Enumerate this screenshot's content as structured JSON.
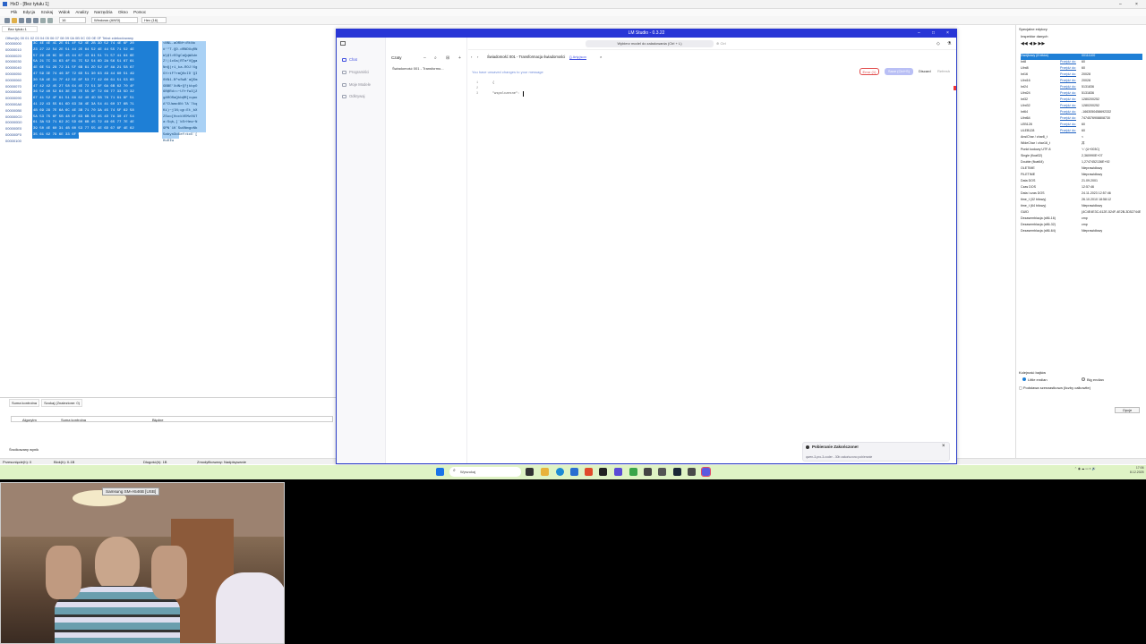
{
  "hxd": {
    "title": "HxD - [Bez tytułu 1]",
    "menu": [
      "Plik",
      "Edycja",
      "Szukaj",
      "Widok",
      "Analizy",
      "Narzędzia",
      "Okno",
      "Pomoc"
    ],
    "toolbar": {
      "cols": "16",
      "charset": "Windows (ANSI)",
      "mode": "Hex (16)"
    },
    "tab": "Bez tytułu 1",
    "header": "Offset(h) 00 01 02 03 04 05 06 07 08 09 0A 0B 0C 0D 0E 0F  Tekst zdekodowany",
    "offsets": [
      "00000000",
      "00000010",
      "00000020",
      "00000030",
      "00000040",
      "00000050",
      "00000060",
      "00000070",
      "00000080",
      "00000090",
      "000000A0",
      "000000B0",
      "000000C0",
      "000000D0",
      "000000E0",
      "000000F0",
      "00000100"
    ],
    "hex_rows": [
      "3C 4E 4E 4C 2E 61 4F 52 4E 2B 3D 52 74 4E 6F 20",
      "23 27 22 54 2E 51 44 2E 64 52 4E 44 55 71 52 4E",
      "57 29 40 6C 3E 45 44 67 43 61 51 71 57 41 64 6E",
      "5A 21 7C 31 63 4F 61 7C 52 54 6D 2A 56 51 67 61",
      "4E 6E 51 28 72 31 5F 6B 61 2D 52 4F 4A 21 58 67",
      "47 59 3E 74 46 3F 72 6D 51 30 63 49 44 60 51 49",
      "30 58 4E 31 7F 42 5E 6F 53 77 42 60 61 51 53 6D",
      "47 42 42 45 27 58 64 4E 72 51 3F 6A 6B 62 70 4F",
      "36 52 40 52 64 3E 3D 7E 55 3F 72 66 77 33 5D 32",
      "67 41 52 4F 61 51 68 62 40 4D 5B 76 71 61 6F 51",
      "41 22 43 55 61 6D 63 38 4E 3A 54 41 60 37 6B 71",
      "4B 69 29 7E 6A 6C 4E 3B 71 70 3A 45 74 5F 62 58",
      "5A 53 75 6F 5B 48 6F 63 6B 56 45 4D 7A 30 47 54",
      "61 3A 53 71 62 2C 5D 60 6B 45 72 48 65 77 7E 4E",
      "39 50 4E 60 31 4B 60 53 77 55 4E 6D 67 6F 4E 62",
      "35 61 62 79 6E 33 6F 58 65 66 3E 6B 63 45 60 5B",
      "48 75 4F 49 77"
    ],
    "ascii_rows": [
      "<NNL.aORN+=RtNo ",
      "#'\"T.QD.dRNDUqRN",
      "W)@l>EDgCaQqWAdn",
      "Z!|1cOa|RTm*VQga",
      "NnQ(r1_ka-ROJ!Xg",
      "GY>tF?rmQ0cID`QI",
      "0XN1.B^oSwB`aQSm",
      "GBBE'XdNrQ?jkbpO",
      "6R@Rd>=~U?rfw3]2",
      "gARORaQhb@M[vqao",
      "A\"CUamc8N:TA`7kq",
      "Ki)~jlN;qp:Et_bX",
      "ZSuo[HockVEMz0GT",
      "a:Sqb,]`kErHew~N",
      "9PN`1K`SwUNmgoNb",
      "5abyn3oXef>kcE`[",
      "HuOIw"
    ],
    "bottom": {
      "tabs": [
        "Suma kontrolna",
        "Szukaj (Znalezione: 0)"
      ],
      "cols": [
        "Algorytm",
        "Suma kontrolna",
        "Błędne"
      ],
      "footer": "Środkowany wynik"
    },
    "status": {
      "pos": "Przesunięcie(h): 0",
      "block": "Blok(h): 0-1B",
      "len": "Długość(h): 1B",
      "mode": "Zmodyfikowany: Nadpisywanie"
    },
    "inspector": {
      "title": "Specjalne edytory",
      "head": "Inspektor danych",
      "link": "Przejdź do:",
      "rows": [
        {
          "n": "Dwójkowy (8 bitów)",
          "l": "",
          "v": "00111100"
        },
        {
          "n": "Int8",
          "l": "Przejdź do:",
          "v": "60"
        },
        {
          "n": "UInt8",
          "l": "Przejdź do:",
          "v": "60"
        },
        {
          "n": "Int16",
          "l": "Przejdź do:",
          "v": "20028"
        },
        {
          "n": "UInt16",
          "l": "Przejdź do:",
          "v": "20028"
        },
        {
          "n": "Int24",
          "l": "Przejdź do:",
          "v": "5131836"
        },
        {
          "n": "UInt24",
          "l": "Przejdź do:",
          "v": "5131836"
        },
        {
          "n": "Int32",
          "l": "Przejdź do:",
          "v": "1280200252"
        },
        {
          "n": "UInt32",
          "l": "Przejdź do:",
          "v": "1280200252"
        },
        {
          "n": "Int64",
          "l": "Przejdź do:",
          "v": "-1663050458692332"
        },
        {
          "n": "UInt64",
          "l": "Przejdź do:",
          "v": "7474576908808730"
        },
        {
          "n": "LEB128",
          "l": "Przejdź do:",
          "v": "60"
        },
        {
          "n": "ULEB128",
          "l": "Przejdź do:",
          "v": "60"
        },
        {
          "n": "AnsiChar / char8_t",
          "l": "",
          "v": "<"
        },
        {
          "n": "WideChar / char16_t",
          "l": "",
          "v": "丼"
        },
        {
          "n": "Punkt kodowy UTF-8",
          "l": "",
          "v": "'<' (U+003C)"
        },
        {
          "n": "Single (float32)",
          "l": "",
          "v": "2,360990E+07"
        },
        {
          "n": "Double (float64)",
          "l": "",
          "v": "1,2747452136E+92"
        },
        {
          "n": "OLETIME",
          "l": "",
          "v": "Nieprawidłowy"
        },
        {
          "n": "FILETIME",
          "l": "",
          "v": "Nieprawidłowy"
        },
        {
          "n": "Data DOS",
          "l": "",
          "v": "21.09.2001"
        },
        {
          "n": "Czas DOS",
          "l": "",
          "v": "12:57:46"
        },
        {
          "n": "Data i czas DOS",
          "l": "",
          "v": "24.11.2023 12:57:46"
        },
        {
          "n": "time_t (32 bitowy)",
          "l": "",
          "v": "26.10.2010 18:58:12"
        },
        {
          "n": "time_t (64 bitowy)",
          "l": "",
          "v": "Nieprawidłowy"
        },
        {
          "n": "GUID",
          "l": "",
          "v": "{4C4E4E3C-612E-524F-4E2B-3D52744E6F20}"
        },
        {
          "n": "Dezasemblacja (x86-16)",
          "l": "",
          "v": "cmp"
        },
        {
          "n": "Dezasemblacja (x86-32)",
          "l": "",
          "v": "cmp"
        },
        {
          "n": "Dezasemblacja (x86-64)",
          "l": "",
          "v": "Nieprawidłowy"
        }
      ],
      "order_title": "Kolejność bajtów",
      "little": "Little endian",
      "big": "Big endian",
      "hex_check": "Podstawa szesnastkowa (liczby całkowite)",
      "options": "Opcje"
    }
  },
  "lm": {
    "title": "LM Studio - 0.3.22",
    "side": [
      "Chat",
      "Programiści",
      "Moje Modele",
      "Odkrywaj"
    ],
    "chat_head": "Czaty",
    "chat_item": "Świadomość 001 - Transformo...",
    "model_pill": "Wybierz model do załadowania  (Ctrl + L)",
    "model_extra": "⊕ Ctrl",
    "crumb": "Świadomość 001 - Transformacja świadomości",
    "file_tab": "{} Arty.json",
    "unsaved": "You have unsaved changes to your message",
    "err_btn": "Error (1)",
    "save_btn": "Save  (Ctrl+S)",
    "discard": "Discard",
    "redo": "Refresh",
    "line_nums": [
      "1",
      "2",
      "3"
    ],
    "code": [
      "{",
      "  \"",
      "  \"wspolczesne\":"
    ],
    "toast_title": "Pobieranie Zakończone!",
    "toast_sub": "qwen-3-pro-3-coder - 30b zakończono pobieranie"
  },
  "taskbar": {
    "search": "Wyszukaj",
    "clock": "17:06",
    "date": "8.12.2025"
  },
  "webcam": {
    "label": "Samsung SM-A546B [USB]"
  }
}
